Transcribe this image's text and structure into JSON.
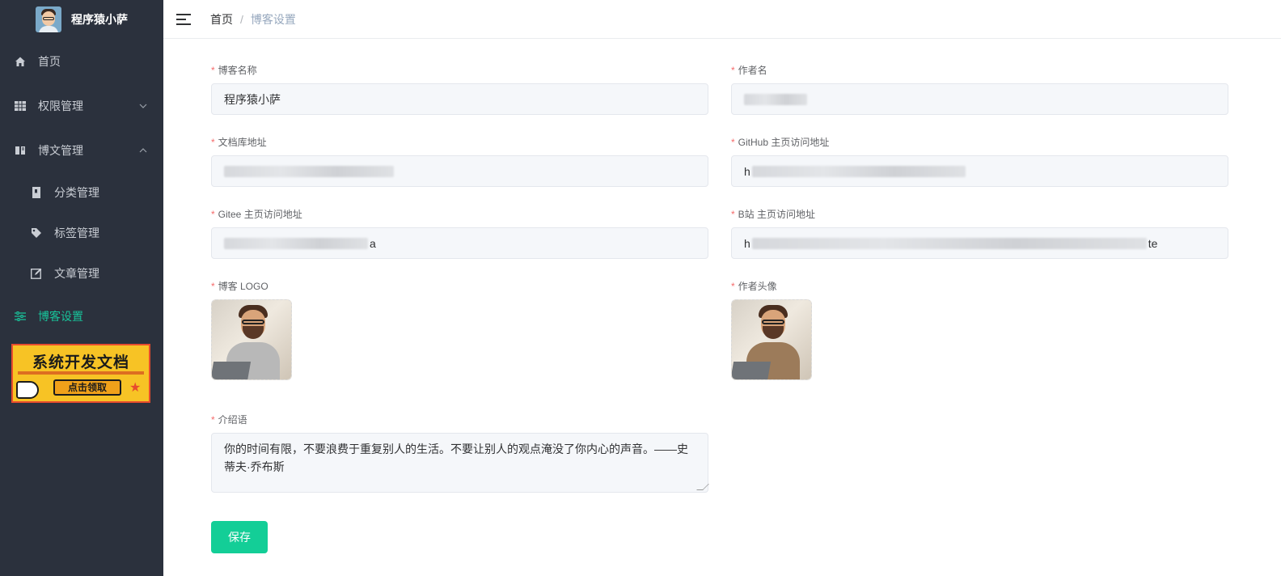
{
  "brand": {
    "name": "程序猿小萨"
  },
  "sidebar": {
    "items": [
      {
        "label": "首页",
        "icon": "home-icon"
      },
      {
        "label": "权限管理",
        "icon": "grid-icon",
        "arrow": "chevron-down-icon"
      },
      {
        "label": "博文管理",
        "icon": "book-icon",
        "arrow": "chevron-up-icon"
      },
      {
        "label": "分类管理",
        "icon": "document-icon"
      },
      {
        "label": "标签管理",
        "icon": "tag-icon"
      },
      {
        "label": "文章管理",
        "icon": "edit-icon"
      },
      {
        "label": "博客设置",
        "icon": "settings-sliders-icon",
        "active": true
      }
    ],
    "promo": {
      "title": "系统开发文档",
      "cta": "点击领取"
    }
  },
  "header": {
    "breadcrumb": [
      "首页",
      "博客设置"
    ],
    "separator": "/"
  },
  "form": {
    "required_mark": "*",
    "blog_name": {
      "label": "博客名称",
      "value": "程序猿小萨"
    },
    "author_name": {
      "label": "作者名"
    },
    "docs_url": {
      "label": "文档库地址"
    },
    "github_url": {
      "label": "GitHub 主页访问地址",
      "visible_prefix": "h"
    },
    "gitee_url": {
      "label": "Gitee 主页访问地址",
      "visible_suffix": "a"
    },
    "bilibili_url": {
      "label": "B站 主页访问地址",
      "visible_prefix": "h",
      "visible_suffix": "te"
    },
    "blog_logo": {
      "label": "博客 LOGO"
    },
    "author_avatar": {
      "label": "作者头像"
    },
    "intro": {
      "label": "介绍语",
      "value": "你的时间有限，不要浪费于重复别人的生活。不要让别人的观点淹没了你内心的声音。——史蒂夫·乔布斯"
    },
    "save_label": "保存"
  },
  "colors": {
    "sidebar_bg": "#2b313d",
    "accent": "#13ce97",
    "active_menu": "#18c39a",
    "required": "#f56c6c"
  }
}
